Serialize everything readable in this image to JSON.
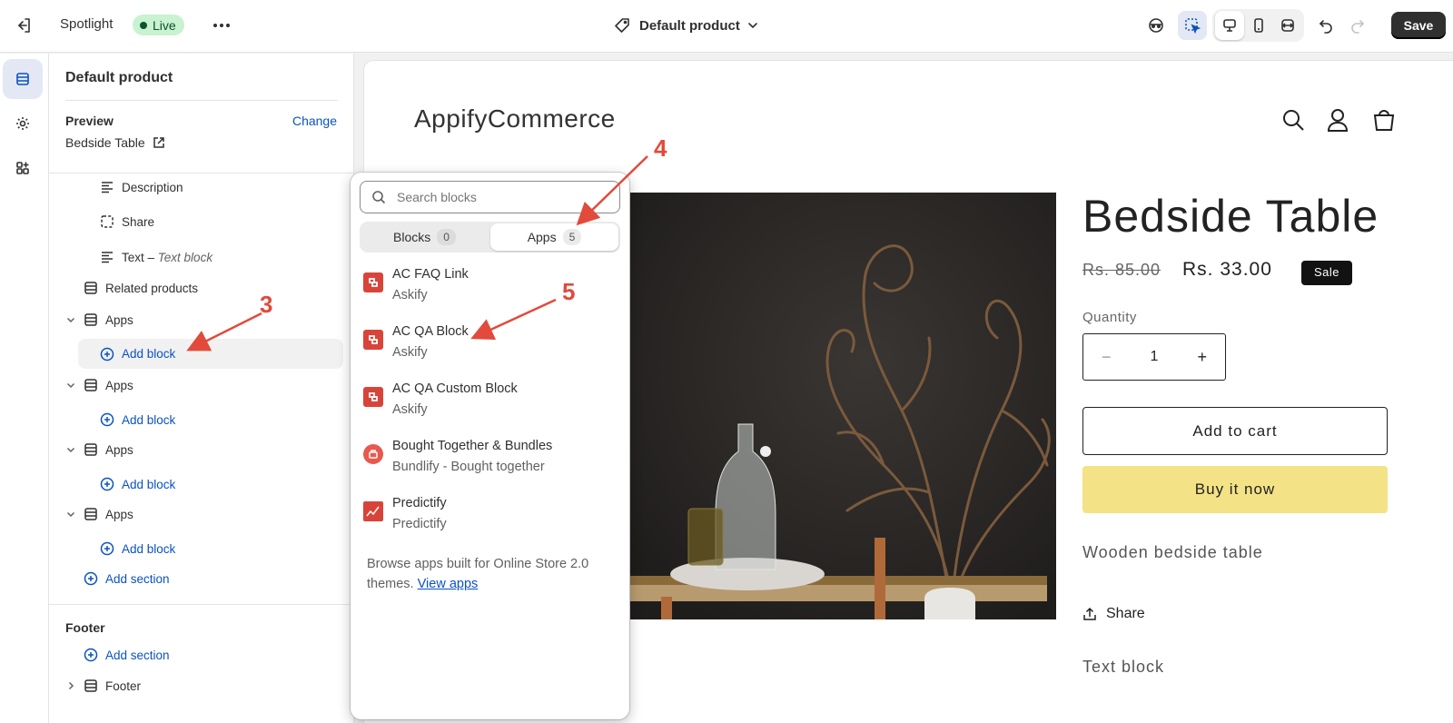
{
  "topbar": {
    "theme_name": "Spotlight",
    "live_badge": "Live",
    "template_label": "Default product",
    "save_label": "Save"
  },
  "sidebar": {
    "title": "Default product",
    "preview_label": "Preview",
    "change_label": "Change",
    "preview_product": "Bedside Table",
    "tree": [
      {
        "label": "Description"
      },
      {
        "label": "Share"
      },
      {
        "label": "Text",
        "sep": " – ",
        "sub": "Text block"
      },
      {
        "label": "Related products"
      },
      {
        "label": "Apps"
      },
      {
        "label": "Add block"
      },
      {
        "label": "Apps"
      },
      {
        "label": "Add block"
      },
      {
        "label": "Apps"
      },
      {
        "label": "Add block"
      },
      {
        "label": "Apps"
      },
      {
        "label": "Add block"
      },
      {
        "label": "Add section"
      }
    ],
    "footer_heading": "Footer",
    "footer_add_section": "Add section",
    "footer_item": "Footer"
  },
  "popup": {
    "search_placeholder": "Search blocks",
    "tabs": [
      {
        "label": "Blocks",
        "count": "0"
      },
      {
        "label": "Apps",
        "count": "5"
      }
    ],
    "apps": [
      {
        "name": "AC FAQ Link",
        "vendor": "Askify"
      },
      {
        "name": "AC QA Block",
        "vendor": "Askify"
      },
      {
        "name": "AC QA Custom Block",
        "vendor": "Askify"
      },
      {
        "name": "Bought Together & Bundles",
        "vendor": "Bundlify - Bought together"
      },
      {
        "name": "Predictify",
        "vendor": "Predictify"
      }
    ],
    "footer_text": "Browse apps built for Online Store 2.0 themes.",
    "footer_link": "View apps"
  },
  "store": {
    "logo_text": "AppifyCommerce",
    "product_title": "Bedside Table",
    "compare_price": "Rs. 85.00",
    "price": "Rs. 33.00",
    "sale_badge": "Sale",
    "quantity_label": "Quantity",
    "quantity_value": "1",
    "add_to_cart": "Add to cart",
    "buy_now": "Buy it now",
    "description": "Wooden bedside table",
    "share_label": "Share",
    "text_block": "Text block"
  },
  "annotations": [
    "3",
    "4",
    "5"
  ],
  "colors": {
    "accent_blue": "#0a52c2",
    "live_green": "#c8f2d0",
    "buy_now_yellow": "#f4e286",
    "annotation_red": "#e24a3b",
    "app_logo_red": "#d9443a"
  }
}
